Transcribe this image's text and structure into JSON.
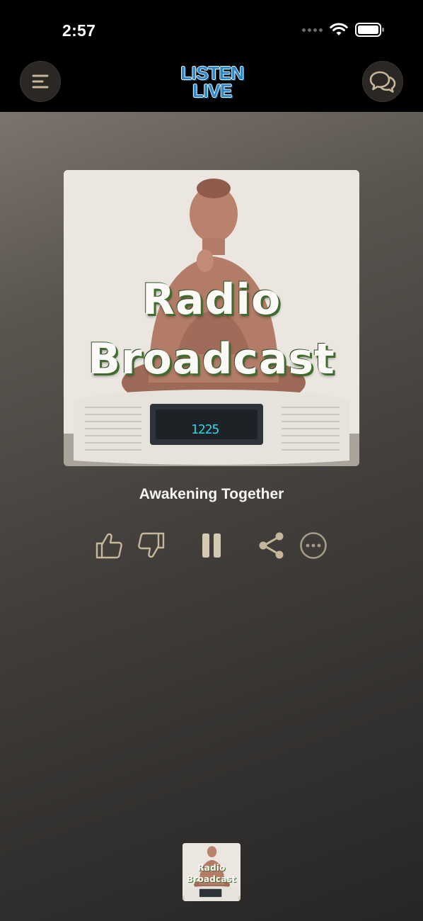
{
  "status_bar": {
    "time": "2:57"
  },
  "header": {
    "logo_line1": "LISTEN",
    "logo_line2": "LIVE",
    "menu_icon": "menu-icon",
    "chat_icon": "chat-bubbles-icon"
  },
  "player": {
    "artwork_title_line1": "Radio",
    "artwork_title_line2": "Broadcast",
    "clock_display": "1225",
    "track_title": "Awakening Together",
    "controls": {
      "thumbs_up_icon": "thumbs-up-icon",
      "thumbs_down_icon": "thumbs-down-icon",
      "pause_icon": "pause-icon",
      "share_icon": "share-icon",
      "more_icon": "more-icon"
    }
  },
  "mini_player": {
    "title_line1": "Radio",
    "title_line2": "Broadcast"
  },
  "colors": {
    "accent": "#c7b79a",
    "logo_blue": "#2d87c9"
  }
}
